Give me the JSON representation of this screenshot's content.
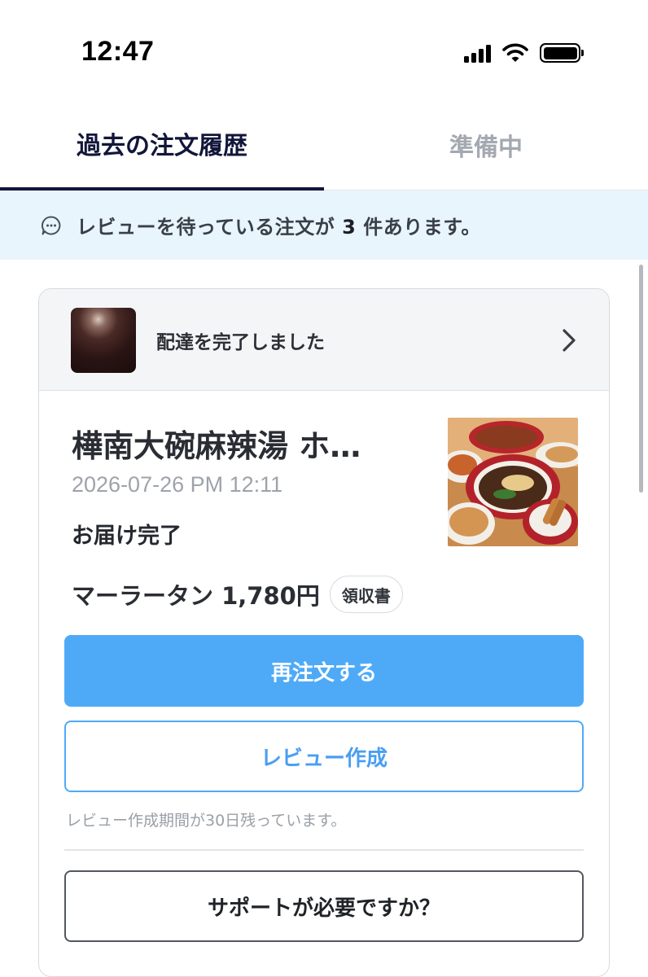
{
  "status_bar": {
    "time": "12:47"
  },
  "tabs": [
    {
      "label": "過去の注文履歴",
      "active": true
    },
    {
      "label": "準備中",
      "active": false
    }
  ],
  "banner": {
    "icon": "chat-bubble-icon",
    "text_before": "レビューを待っている注文が",
    "count": "3",
    "text_after": "件あります。"
  },
  "order": {
    "header_status": "配達を完了しました",
    "store_name": "樺南大碗麻辣湯 ホ…",
    "date": "2026-07-26 PM 12:11",
    "status": "お届け完了",
    "summary": "マーラータン 1,780円",
    "receipt_label": "領収書",
    "reorder_label": "再注文する",
    "review_label": "レビュー作成",
    "review_note": "レビュー作成期間が30日残っています。",
    "support_label": "サポートが必要ですか？"
  },
  "colors": {
    "accent": "#4eaaf7",
    "banner_bg": "#e8f5fc",
    "active_tab": "#12163a",
    "inactive_tab": "#a4a9b1"
  }
}
